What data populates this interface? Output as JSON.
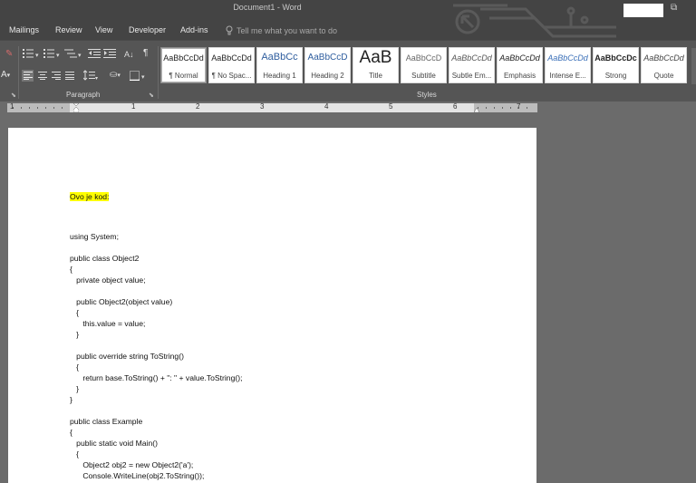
{
  "window": {
    "title": "Document1  -  Word"
  },
  "tabs": [
    "Mailings",
    "Review",
    "View",
    "Developer",
    "Add-ins"
  ],
  "tell_me": {
    "placeholder": "Tell me what you want to do"
  },
  "ribbon": {
    "groups": {
      "paragraph": "Paragraph",
      "styles": "Styles"
    },
    "styles": [
      {
        "sample": "AaBbCcDd",
        "name": "¶ Normal",
        "selected": true
      },
      {
        "sample": "AaBbCcDd",
        "name": "¶ No Spac..."
      },
      {
        "sample": "AaBbCc",
        "name": "Heading 1"
      },
      {
        "sample": "AaBbCcD",
        "name": "Heading 2"
      },
      {
        "sample": "AaB",
        "name": "Title"
      },
      {
        "sample": "AaBbCcD",
        "name": "Subtitle"
      },
      {
        "sample": "AaBbCcDd",
        "name": "Subtle Em..."
      },
      {
        "sample": "AaBbCcDd",
        "name": "Emphasis"
      },
      {
        "sample": "AaBbCcDd",
        "name": "Intense E..."
      },
      {
        "sample": "AaBbCcDc",
        "name": "Strong"
      },
      {
        "sample": "AaBbCcDd",
        "name": "Quote"
      }
    ],
    "glyphs": {
      "font_color": "A",
      "paragraph_mark": "¶"
    }
  },
  "ruler": {
    "numbers": [
      "1",
      "1",
      "2",
      "3",
      "4",
      "5",
      "6",
      "7"
    ]
  },
  "document": {
    "lines": [
      "Ovo je kod:",
      "using System;",
      "public class Object2",
      "{",
      "   private object value;",
      "   public Object2(object value)",
      "   {",
      "      this.value = value;",
      "   }",
      "   public override string ToString()",
      "   {",
      "      return base.ToString() + \": \" + value.ToString();",
      "   }",
      "}",
      "public class Example",
      "{",
      "   public static void Main()",
      "   {",
      "      Object2 obj2 = new Object2('a');",
      "      Console.WriteLine(obj2.ToString());"
    ]
  },
  "colors": {
    "highlight": "#ffff00",
    "chrome": "#444444",
    "ribbon": "#555555"
  }
}
